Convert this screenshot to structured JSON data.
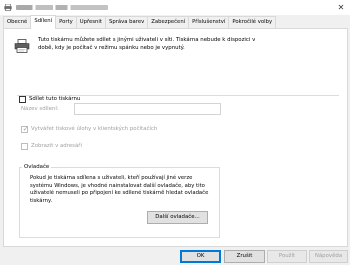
{
  "window": {
    "title": "Vlastnosti tiskárny",
    "close_glyph": "✕"
  },
  "tabs": [
    {
      "label": "Obecné"
    },
    {
      "label": "Sdílení"
    },
    {
      "label": "Porty"
    },
    {
      "label": "Upřesnit"
    },
    {
      "label": "Správa barev"
    },
    {
      "label": "Zabezpečení"
    },
    {
      "label": "Příslušenství"
    },
    {
      "label": "Pokročilé volby"
    }
  ],
  "active_tab": "Sdílení",
  "sharing": {
    "intro_text": "Tuto tiskárnu můžete sdílet s jinými uživateli v síti. Tiskárna nebude k dispozici v době, kdy je počítač v režimu spánku nebo je vypnutý.",
    "share_checkbox_label": "Sdílet tuto tiskárnu",
    "share_checked": false,
    "share_name_label": "Název sdílení:",
    "share_name_value": "",
    "render_jobs_label": "Vytvářet tiskové úlohy v klientských počítačích",
    "render_jobs_checked": true,
    "list_directory_label": "Zobrazit v adresáři",
    "list_directory_checked": false
  },
  "drivers": {
    "group_label": "Ovladače",
    "text": "Pokud je tiskárna sdílena s uživateli, kteří používají jiné verze systému Windows, je vhodné nainstalovat další ovladače, aby tito uživatelé nemuseli po připojení ke sdílené tiskárně hledat ovladače tiskárny.",
    "button_label": "Další ovladače..."
  },
  "footer": {
    "ok_label": "OK",
    "cancel_label": "Zrušit",
    "apply_label": "Použít",
    "help_label": "Nápověda"
  },
  "icons": {
    "printer": "printer-icon",
    "window": "printer-window-icon"
  }
}
